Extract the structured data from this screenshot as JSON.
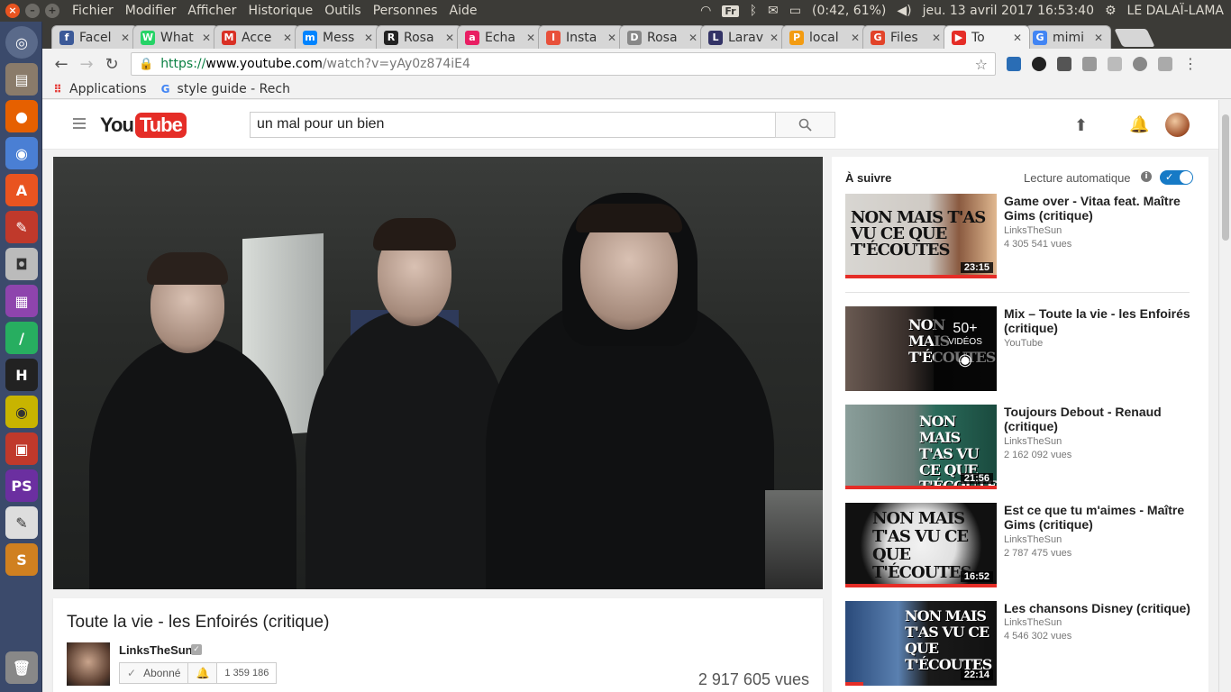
{
  "os": {
    "menu": [
      "Fichier",
      "Modifier",
      "Afficher",
      "Historique",
      "Outils",
      "Personnes",
      "Aide"
    ],
    "keyboard": "Fr",
    "battery": "(0:42, 61%)",
    "datetime": "jeu. 13 avril 2017 16:53:40",
    "user": "LE DALAÏ-LAMA"
  },
  "tabs": [
    {
      "label": "Facel",
      "color": "#3b5998",
      "glyph": "f"
    },
    {
      "label": "What",
      "color": "#25d366",
      "glyph": "W"
    },
    {
      "label": "Acce",
      "color": "#d93025",
      "glyph": "M"
    },
    {
      "label": "Mess",
      "color": "#0084ff",
      "glyph": "m"
    },
    {
      "label": "Rosa",
      "color": "#222222",
      "glyph": "R"
    },
    {
      "label": "Echa",
      "color": "#e91e63",
      "glyph": "a"
    },
    {
      "label": "Insta",
      "color": "#e8503a",
      "glyph": "I"
    },
    {
      "label": "Rosa",
      "color": "#888888",
      "glyph": "D"
    },
    {
      "label": "Larav",
      "color": "#333366",
      "glyph": "L"
    },
    {
      "label": "local",
      "color": "#f39c12",
      "glyph": "P"
    },
    {
      "label": "Files",
      "color": "#e24329",
      "glyph": "G"
    },
    {
      "label": "To",
      "color": "#e52d27",
      "glyph": "▶"
    },
    {
      "label": "mimi",
      "color": "#4285f4",
      "glyph": "G"
    }
  ],
  "address": {
    "secure": "https://",
    "host": "www.youtube.com",
    "path": "/watch?v=yAy0z874iE4"
  },
  "bookmarks": [
    {
      "label": "Applications"
    },
    {
      "label": "style guide - Rech"
    }
  ],
  "youtube": {
    "logo_you": "You",
    "logo_tube": "Tube",
    "search_query": "un mal pour un bien"
  },
  "video": {
    "title": "Toute la vie - les Enfoirés (critique)",
    "channel": "LinksTheSun",
    "subscribe_label": "Abonné",
    "subscriber_count": "1 359 186",
    "views": "2 917 605 vues"
  },
  "sidebar": {
    "up_next": "À suivre",
    "autoplay": "Lecture automatique",
    "items": [
      {
        "title": "Game over - Vitaa feat. Maître Gims (critique)",
        "channel": "LinksTheSun",
        "views": "4 305 541 vues",
        "duration": "23:15",
        "thumb_text": "NON MAIS T'AS VU CE QUE T'ÉCOUTES"
      },
      {
        "title": "Mix – Toute la vie - les Enfoirés (critique)",
        "channel": "YouTube",
        "views": "",
        "duration": "",
        "mix_count": "50+",
        "mix_label": "VIDÉOS",
        "thumb_text": "NON MAIS T'ÉCOUTES"
      },
      {
        "title": "Toujours Debout - Renaud (critique)",
        "channel": "LinksTheSun",
        "views": "2 162 092 vues",
        "duration": "21:56",
        "thumb_text": "NON MAIS T'AS VU CE QUE T'ÉCOUTES"
      },
      {
        "title": "Est ce que tu m'aimes - Maître Gims (critique)",
        "channel": "LinksTheSun",
        "views": "2 787 475 vues",
        "duration": "16:52",
        "thumb_text": "NON MAIS T'AS VU CE QUE T'ÉCOUTES"
      },
      {
        "title": "Les chansons Disney (critique)",
        "channel": "LinksTheSun",
        "views": "4 546 302 vues",
        "duration": "22:14",
        "thumb_text": "NON MAIS T'AS VU CE QUE T'ÉCOUTES"
      }
    ]
  }
}
